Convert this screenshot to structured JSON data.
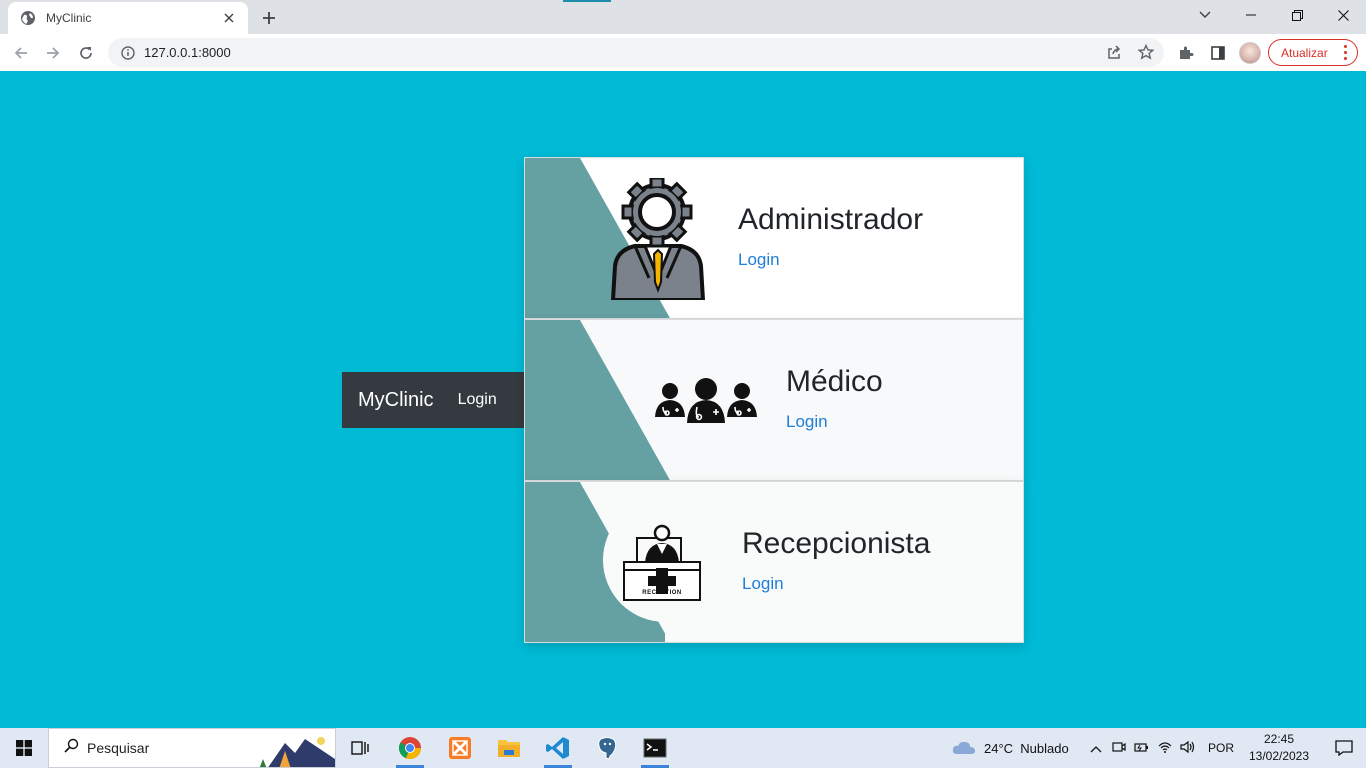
{
  "browser": {
    "tab_title": "MyClinic",
    "url": "127.0.0.1:8000",
    "update_label": "Atualizar"
  },
  "page": {
    "navbar": {
      "brand": "MyClinic",
      "login": "Login"
    },
    "cards": [
      {
        "title": "Administrador",
        "link": "Login",
        "icon": "admin-gear-person-icon"
      },
      {
        "title": "Médico",
        "link": "Login",
        "icon": "doctors-group-icon"
      },
      {
        "title": "Recepcionista",
        "link": "Login",
        "icon": "reception-desk-icon",
        "desk_label": "RECEPTION"
      }
    ]
  },
  "taskbar": {
    "search_placeholder": "Pesquisar",
    "weather": "24°C  Nublado",
    "language": "POR",
    "time": "22:45",
    "date": "13/02/2023"
  },
  "colors": {
    "page_bg": "#00bad6",
    "card_accent": "#65a0a2",
    "navbar_bg": "#343a40",
    "link": "#1e7ed8"
  }
}
